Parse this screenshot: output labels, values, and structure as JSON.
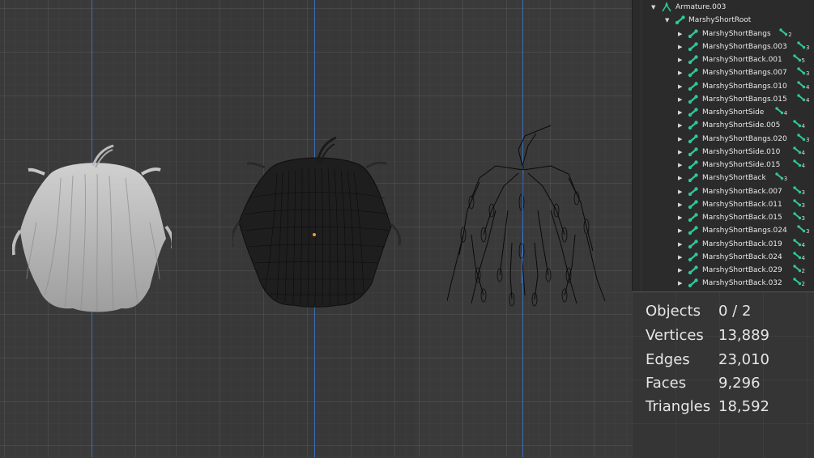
{
  "outliner": {
    "items": [
      {
        "label": "Armature.003",
        "level": 0,
        "icon": "armature-icon"
      },
      {
        "label": "MarshyShortRoot",
        "level": 1,
        "icon": "bone-icon"
      },
      {
        "label": "MarshyShortBangs",
        "level": 2,
        "badge": "2"
      },
      {
        "label": "MarshyShortBangs.003",
        "level": 2,
        "badge": "3"
      },
      {
        "label": "MarshyShortBack.001",
        "level": 2,
        "badge": "5"
      },
      {
        "label": "MarshyShortBangs.007",
        "level": 2,
        "badge": "3"
      },
      {
        "label": "MarshyShortBangs.010",
        "level": 2,
        "badge": "4"
      },
      {
        "label": "MarshyShortBangs.015",
        "level": 2,
        "badge": "4"
      },
      {
        "label": "MarshyShortSide",
        "level": 2,
        "badge": "4"
      },
      {
        "label": "MarshyShortSide.005",
        "level": 2,
        "badge": "4"
      },
      {
        "label": "MarshyShortBangs.020",
        "level": 2,
        "badge": "3"
      },
      {
        "label": "MarshyShortSide.010",
        "level": 2,
        "badge": "4"
      },
      {
        "label": "MarshyShortSide.015",
        "level": 2,
        "badge": "4"
      },
      {
        "label": "MarshyShortBack",
        "level": 2,
        "badge": "3"
      },
      {
        "label": "MarshyShortBack.007",
        "level": 2,
        "badge": "3"
      },
      {
        "label": "MarshyShortBack.011",
        "level": 2,
        "badge": "3"
      },
      {
        "label": "MarshyShortBack.015",
        "level": 2,
        "badge": "3"
      },
      {
        "label": "MarshyShortBangs.024",
        "level": 2,
        "badge": "3"
      },
      {
        "label": "MarshyShortBack.019",
        "level": 2,
        "badge": "4"
      },
      {
        "label": "MarshyShortBack.024",
        "level": 2,
        "badge": "4"
      },
      {
        "label": "MarshyShortBack.029",
        "level": 2,
        "badge": "2"
      },
      {
        "label": "MarshyShortBack.032",
        "level": 2,
        "badge": "2"
      }
    ]
  },
  "stats": {
    "objects_label": "Objects",
    "objects_value": "0 / 2",
    "vertices_label": "Vertices",
    "vertices_value": "13,889",
    "edges_label": "Edges",
    "edges_value": "23,010",
    "faces_label": "Faces",
    "faces_value": "9,296",
    "triangles_label": "Triangles",
    "triangles_value": "18,592"
  },
  "colors": {
    "bone_icon": "#2fc79a",
    "axis_blue": "#3e6fb8",
    "origin_dot": "#ff9a1a"
  }
}
